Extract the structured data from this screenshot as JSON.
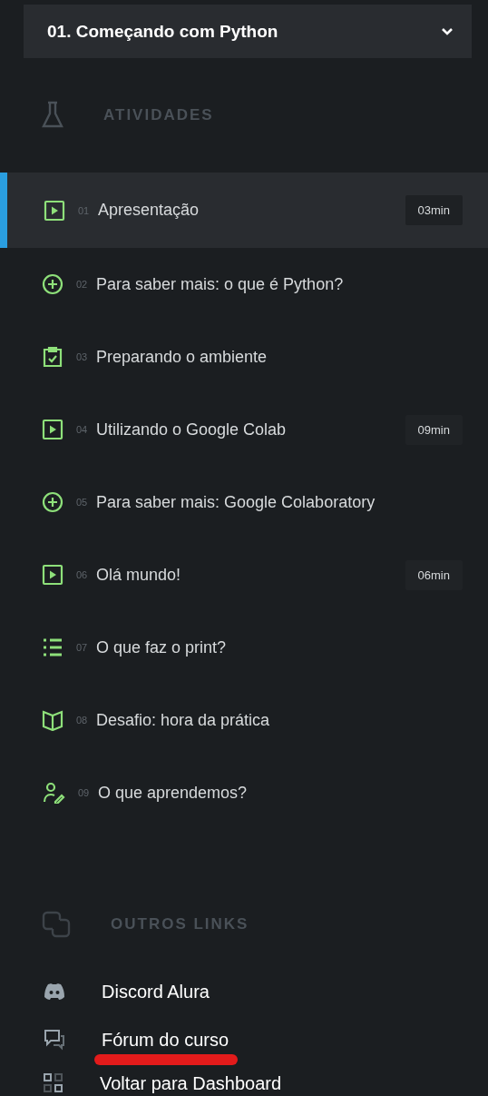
{
  "section_select": {
    "title": "01. Começando com Python",
    "expanded": false
  },
  "activities": {
    "heading": "ATIVIDADES",
    "items": [
      {
        "kind": "video",
        "number": "01",
        "title": "Apresentação",
        "duration": "03min",
        "selected": true
      },
      {
        "kind": "extra",
        "number": "02",
        "title": "Para saber mais: o que é Python?",
        "selected": false
      },
      {
        "kind": "task",
        "number": "03",
        "title": "Preparando o ambiente",
        "selected": false
      },
      {
        "kind": "video",
        "number": "04",
        "title": "Utilizando o Google Colab",
        "duration": "09min",
        "selected": false
      },
      {
        "kind": "extra",
        "number": "05",
        "title": "Para saber mais: Google Colaboratory",
        "selected": false
      },
      {
        "kind": "video",
        "number": "06",
        "title": "Olá mundo!",
        "duration": "06min",
        "selected": false
      },
      {
        "kind": "quiz",
        "number": "07",
        "title": "O que faz o print?",
        "selected": false
      },
      {
        "kind": "challenge",
        "number": "08",
        "title": "Desafio: hora da prática",
        "selected": false
      },
      {
        "kind": "summary",
        "number": "09",
        "title": "O que aprendemos?",
        "selected": false
      }
    ]
  },
  "other_links": {
    "heading": "OUTROS LINKS",
    "items": [
      {
        "kind": "discord",
        "label": "Discord Alura",
        "underlined": false
      },
      {
        "kind": "forum",
        "label": "Fórum do curso",
        "underlined": true
      },
      {
        "kind": "dashboard",
        "label": "Voltar para Dashboard",
        "underlined": false
      }
    ]
  }
}
